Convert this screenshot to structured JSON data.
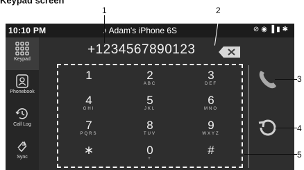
{
  "heading": "Keypad screen",
  "callouts": [
    "1",
    "2",
    "3",
    "4",
    "5"
  ],
  "status_bar": {
    "time": "10:10 PM",
    "device_name": "Adam's iPhone 6S"
  },
  "sidebar": {
    "items": [
      {
        "label": "Keypad",
        "icon": "keypad-grid-icon",
        "active": true
      },
      {
        "label": "Phonebook",
        "icon": "phonebook-icon",
        "active": false
      },
      {
        "label": "Call Log",
        "icon": "call-log-icon",
        "active": false
      },
      {
        "label": "Sync",
        "icon": "sync-icon",
        "active": false
      }
    ]
  },
  "dial": {
    "number": "+1234567890123"
  },
  "keypad": {
    "keys": [
      {
        "digit": "1",
        "letters": ""
      },
      {
        "digit": "2",
        "letters": "ABC"
      },
      {
        "digit": "3",
        "letters": "DEF"
      },
      {
        "digit": "4",
        "letters": "GHI"
      },
      {
        "digit": "5",
        "letters": "JKL"
      },
      {
        "digit": "6",
        "letters": "MNO"
      },
      {
        "digit": "7",
        "letters": "PQRS"
      },
      {
        "digit": "8",
        "letters": "TUV"
      },
      {
        "digit": "9",
        "letters": "WXYZ"
      },
      {
        "digit": "∗",
        "letters": ""
      },
      {
        "digit": "0",
        "letters": "+"
      },
      {
        "digit": "#",
        "letters": ""
      }
    ]
  },
  "colors": {
    "screen_bg": "#2e2e2e",
    "status_bg": "#1c1c1c",
    "text": "#f2f2f2",
    "accent_icon": "#a9a9a9"
  }
}
